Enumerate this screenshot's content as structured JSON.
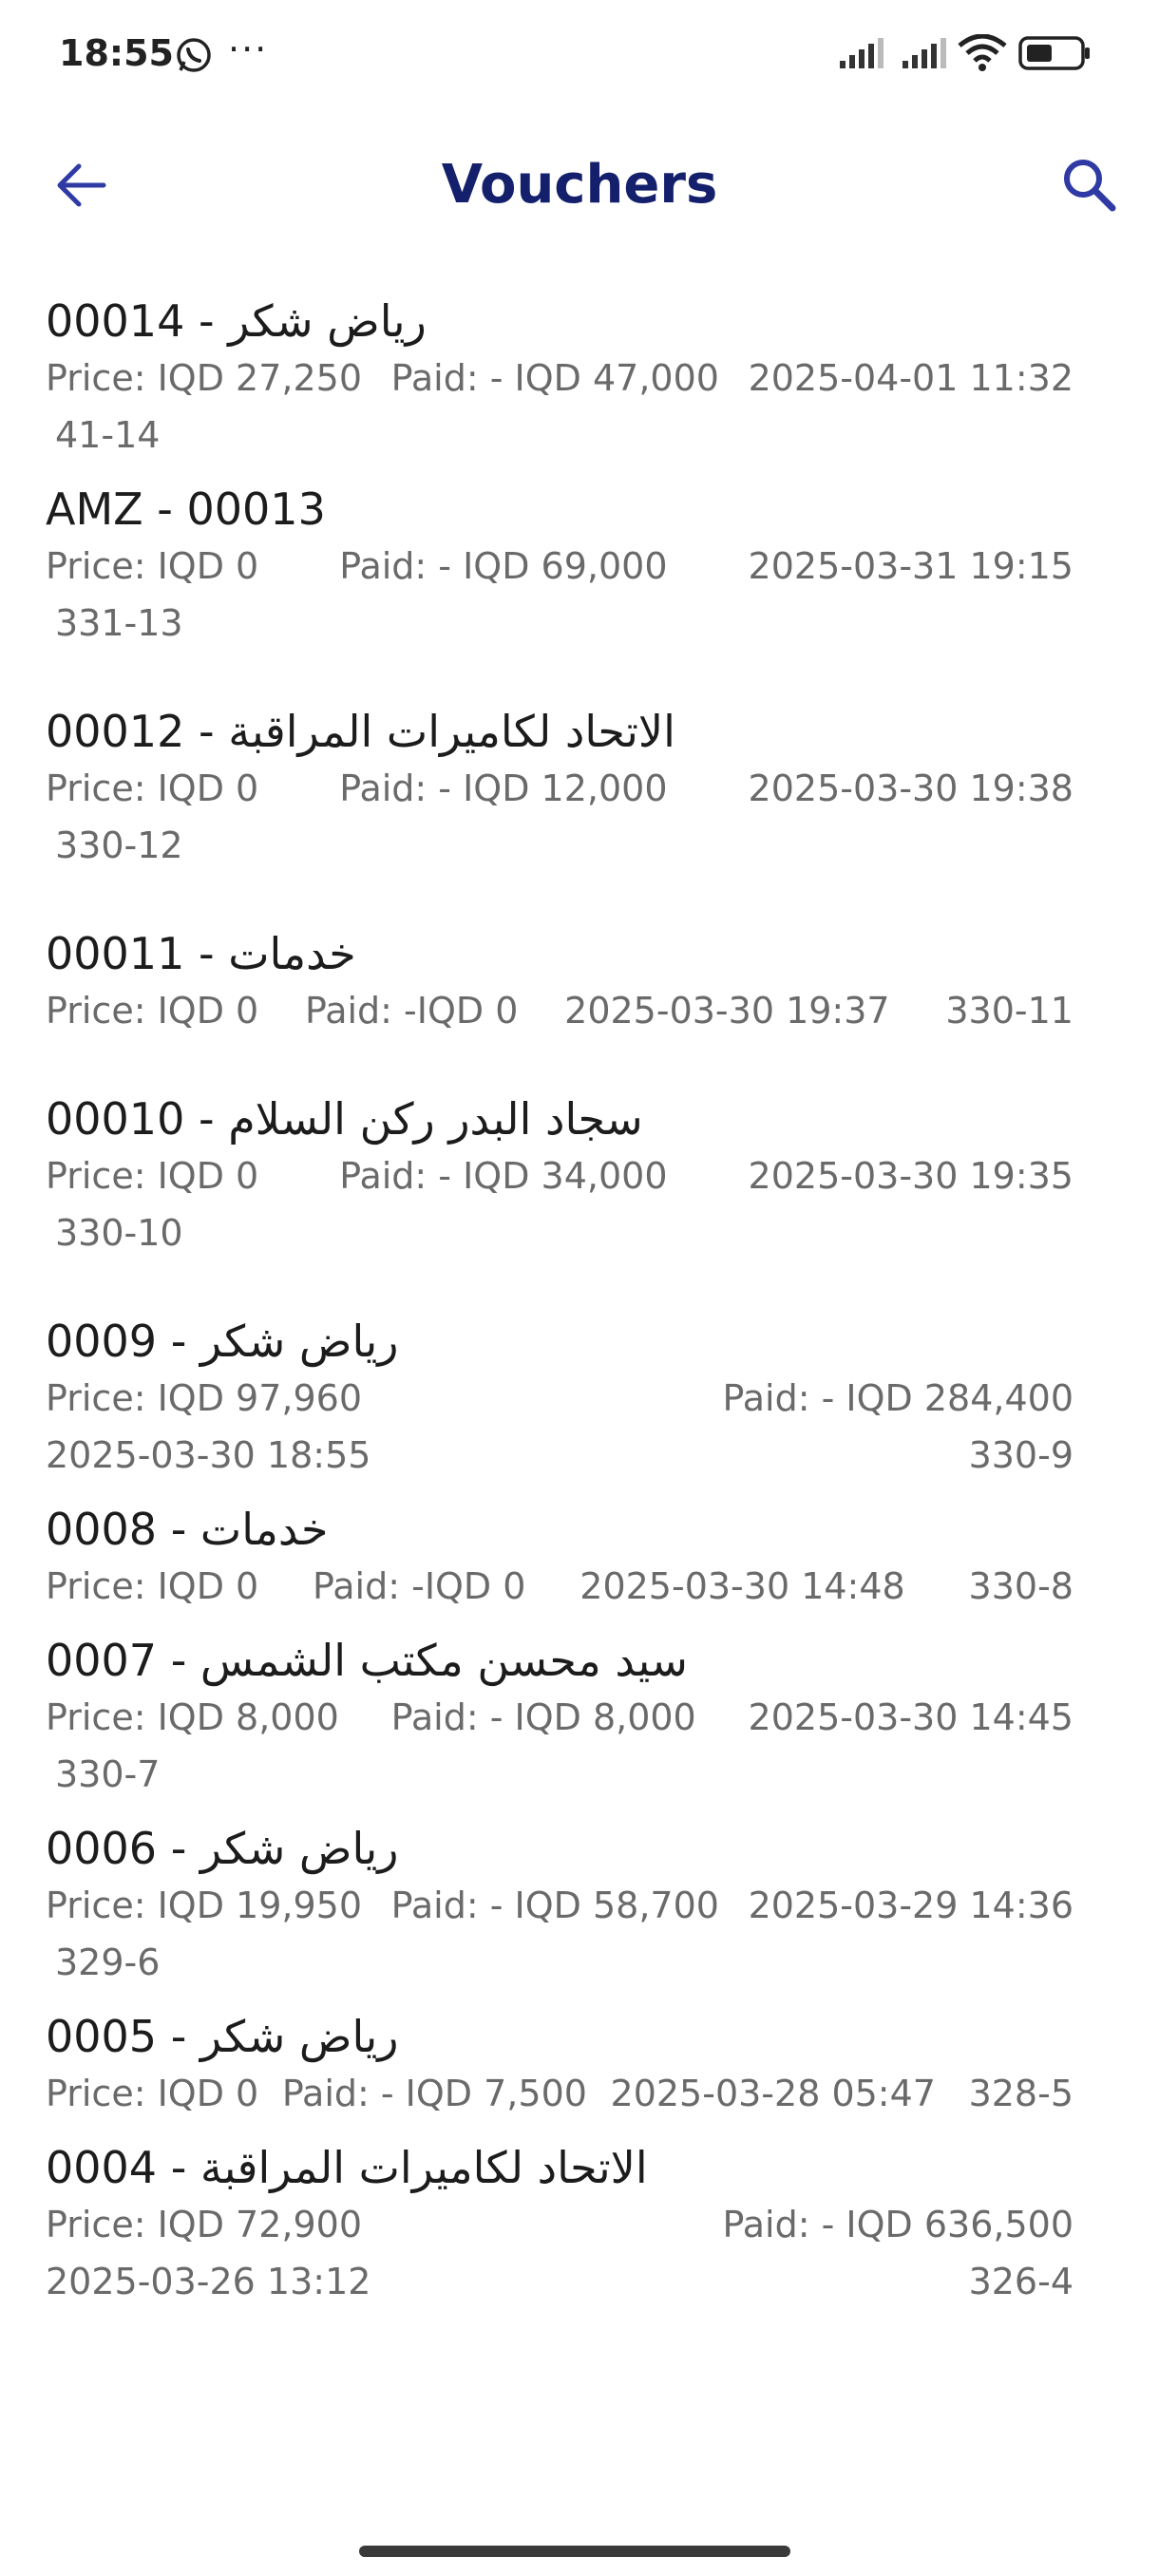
{
  "status_bar": {
    "time": "18:55",
    "more": "···"
  },
  "app_bar": {
    "title": "Vouchers",
    "back_icon": "arrow-left-icon",
    "search_icon": "search-icon",
    "accent": "#2f3aa4",
    "title_color": "#14206b"
  },
  "vouchers": [
    {
      "title": "00014 - رياض شكر",
      "price": "Price: IQD 27,250",
      "paid": "Paid: -  IQD 47,000",
      "date": "2025-04-01 11:32",
      "code": "41-14"
    },
    {
      "title": "AMZ - 00013",
      "price": "Price: IQD 0",
      "paid": "Paid: -  IQD 69,000",
      "date": "2025-03-31 19:15",
      "code": "331-13"
    },
    {
      "title": "00012 -  الاتحاد لكاميرات المراقبة",
      "price": "Price: IQD 0",
      "paid": "Paid: -  IQD 12,000",
      "date": "2025-03-30 19:38",
      "code": "330-12"
    },
    {
      "title": "00011 -  خدمات",
      "price": "Price: IQD 0",
      "paid": "Paid: -IQD 0",
      "date": "2025-03-30 19:37",
      "code": "330-11"
    },
    {
      "title": "00010 -  سجاد البدر ركن السلام",
      "price": "Price: IQD 0",
      "paid": "Paid: -  IQD 34,000",
      "date": "2025-03-30 19:35",
      "code": "330-10"
    },
    {
      "title": "0009 - رياض شكر",
      "price": "Price: IQD 97,960",
      "paid": "Paid: -  IQD 284,400",
      "date": "2025-03-30 18:55",
      "code": "330-9"
    },
    {
      "title": "0008 -  خدمات",
      "price": "Price: IQD 0",
      "paid": "Paid: -IQD 0",
      "date": "2025-03-30 14:48",
      "code": "330-8"
    },
    {
      "title": "0007 -  سيد محسن مكتب الشمس",
      "price": "Price: IQD 8,000",
      "paid": "Paid: -  IQD 8,000",
      "date": "2025-03-30 14:45",
      "code": "330-7"
    },
    {
      "title": "0006 - رياض شكر",
      "price": "Price: IQD 19,950",
      "paid": "Paid: -  IQD 58,700",
      "date": "2025-03-29 14:36",
      "code": "329-6"
    },
    {
      "title": "0005 - رياض شكر",
      "price": "Price: IQD 0",
      "paid": "Paid: -  IQD 7,500",
      "date": "2025-03-28 05:47",
      "code": "328-5"
    },
    {
      "title": "0004 -  الاتحاد لكاميرات المراقبة",
      "price": "Price: IQD 72,900",
      "paid": "Paid: -  IQD 636,500",
      "date": "2025-03-26 13:12",
      "code": "326-4"
    }
  ]
}
